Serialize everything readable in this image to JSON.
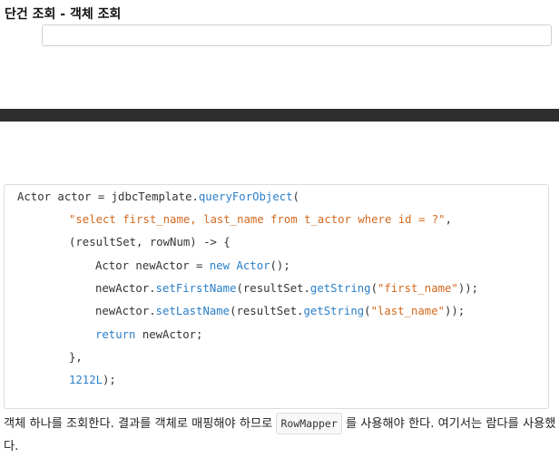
{
  "heading": "단건 조회 - 객체 조회",
  "code": {
    "l1_a": "Actor actor = jdbcTemplate.",
    "l1_fn": "queryForObject",
    "l1_b": "(",
    "l2_str": "\"select first_name, last_name from t_actor where id = ?\"",
    "l2_b": ",",
    "l3": "(resultSet, rowNum) -> {",
    "l4_a": "Actor newActor = ",
    "l4_kw": "new",
    "l4_sp": " ",
    "l4_fn": "Actor",
    "l4_b": "();",
    "l5_a": "newActor.",
    "l5_fn": "setFirstName",
    "l5_b": "(resultSet.",
    "l5_fn2": "getString",
    "l5_c": "(",
    "l5_str": "\"first_name\"",
    "l5_d": "));",
    "l6_a": "newActor.",
    "l6_fn": "setLastName",
    "l6_b": "(resultSet.",
    "l6_fn2": "getString",
    "l6_c": "(",
    "l6_str": "\"last_name\"",
    "l6_d": "));",
    "l7_kw": "return",
    "l7_b": " newActor;",
    "l8": "},",
    "l9_num": "1212L",
    "l9_b": ");"
  },
  "description": {
    "before": "객체 하나를 조회한다. 결과를 객체로 매핑해야 하므로 ",
    "code": "RowMapper",
    "after": " 를 사용해야 한다. 여기서는 람다를 사용했다."
  }
}
